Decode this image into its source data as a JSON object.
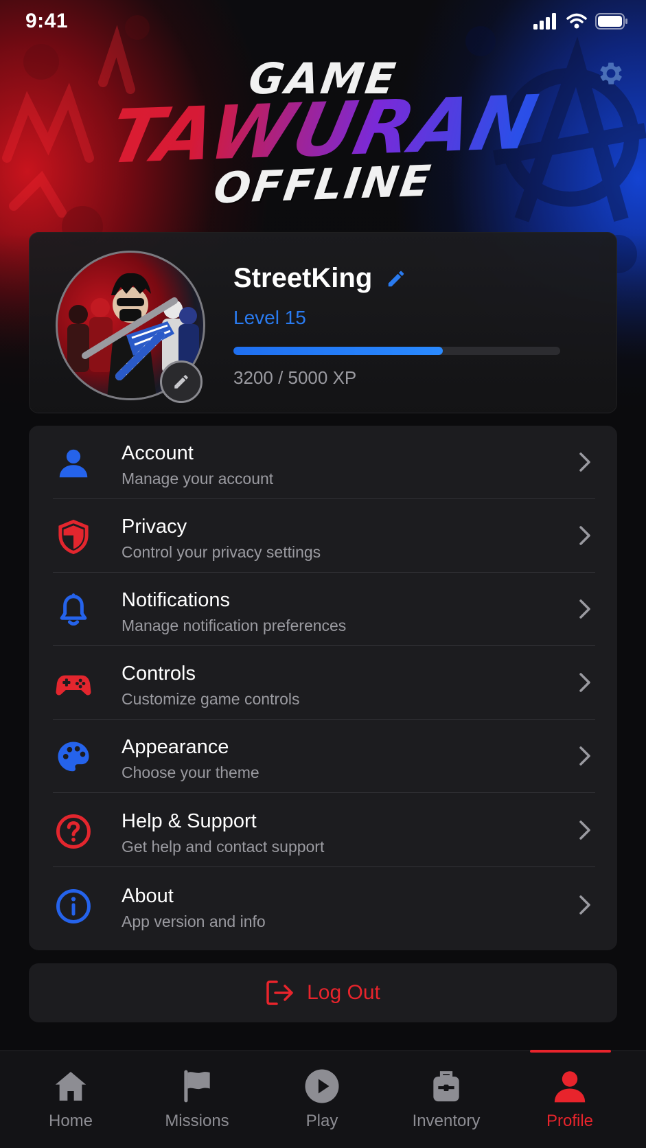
{
  "status_bar": {
    "time": "9:41"
  },
  "logo": {
    "line1": "GAME",
    "line2": "TAWURAN",
    "line3": "OFFLINE"
  },
  "profile": {
    "username": "StreetKing",
    "level_text": "Level 15",
    "xp_text": "3200 / 5000 XP",
    "xp_progress": 0.64
  },
  "settings": [
    {
      "title": "Account",
      "subtitle": "Manage your account",
      "icon": "user-icon",
      "color": "#2563eb"
    },
    {
      "title": "Privacy",
      "subtitle": "Control your privacy settings",
      "icon": "shield-icon",
      "color": "#e3262e"
    },
    {
      "title": "Notifications",
      "subtitle": "Manage notification preferences",
      "icon": "bell-icon",
      "color": "#2563eb"
    },
    {
      "title": "Controls",
      "subtitle": "Customize game controls",
      "icon": "gamepad-icon",
      "color": "#e3262e"
    },
    {
      "title": "Appearance",
      "subtitle": "Choose your theme",
      "icon": "palette-icon",
      "color": "#2563eb"
    },
    {
      "title": "Help & Support",
      "subtitle": "Get help and contact support",
      "icon": "help-icon",
      "color": "#e3262e"
    },
    {
      "title": "About",
      "subtitle": "App version and info",
      "icon": "info-icon",
      "color": "#2563eb"
    }
  ],
  "logout": {
    "label": "Log Out"
  },
  "tabs": [
    {
      "label": "Home",
      "icon": "home-icon"
    },
    {
      "label": "Missions",
      "icon": "flag-icon"
    },
    {
      "label": "Play",
      "icon": "play-icon"
    },
    {
      "label": "Inventory",
      "icon": "backpack-icon"
    },
    {
      "label": "Profile",
      "icon": "profile-icon",
      "active": true
    }
  ],
  "colors": {
    "accent_red": "#e8242c",
    "accent_blue": "#2a7bf0",
    "background": "#0b0b0d",
    "card": "#1c1c1f"
  }
}
